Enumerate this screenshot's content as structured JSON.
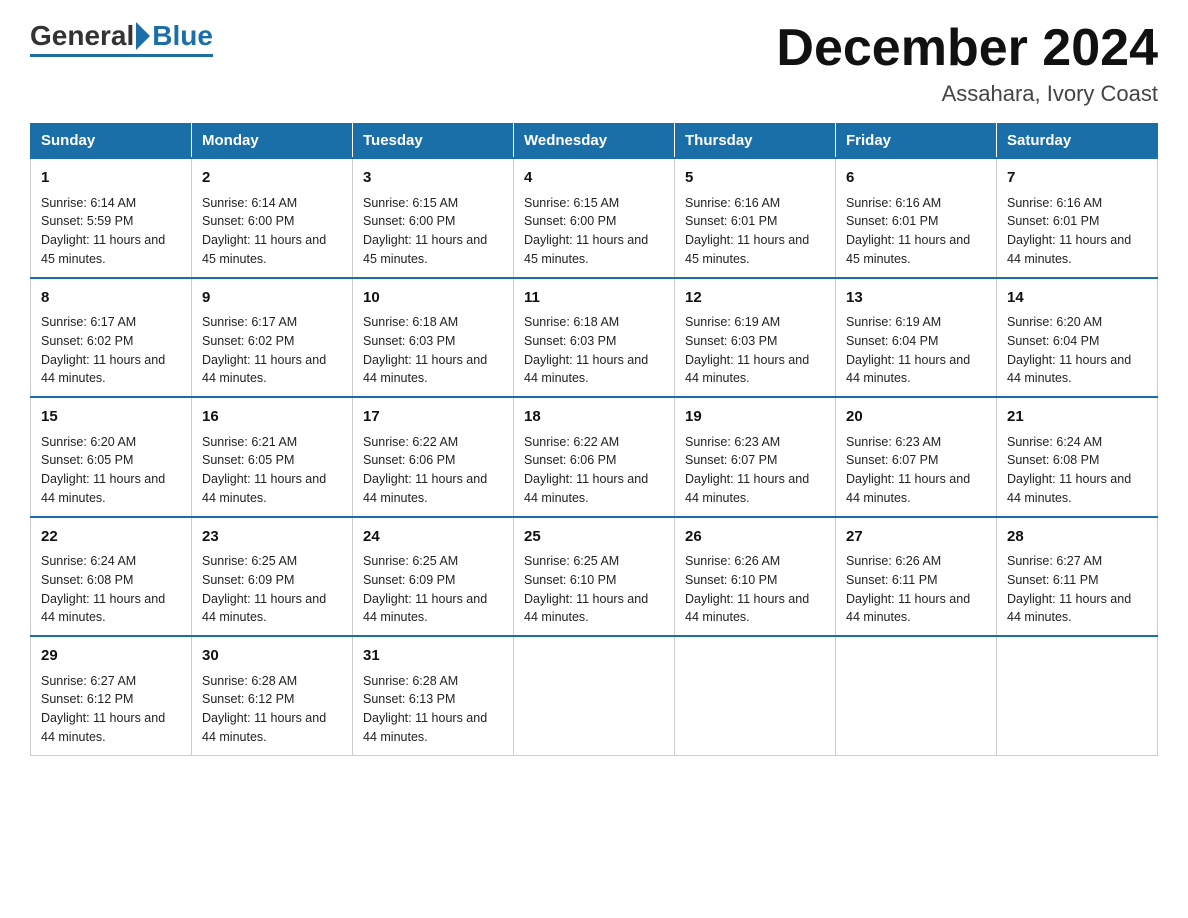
{
  "logo": {
    "general": "General",
    "blue": "Blue"
  },
  "title": "December 2024",
  "location": "Assahara, Ivory Coast",
  "weekdays": [
    "Sunday",
    "Monday",
    "Tuesday",
    "Wednesday",
    "Thursday",
    "Friday",
    "Saturday"
  ],
  "weeks": [
    [
      {
        "day": "1",
        "sunrise": "6:14 AM",
        "sunset": "5:59 PM",
        "daylight": "11 hours and 45 minutes."
      },
      {
        "day": "2",
        "sunrise": "6:14 AM",
        "sunset": "6:00 PM",
        "daylight": "11 hours and 45 minutes."
      },
      {
        "day": "3",
        "sunrise": "6:15 AM",
        "sunset": "6:00 PM",
        "daylight": "11 hours and 45 minutes."
      },
      {
        "day": "4",
        "sunrise": "6:15 AM",
        "sunset": "6:00 PM",
        "daylight": "11 hours and 45 minutes."
      },
      {
        "day": "5",
        "sunrise": "6:16 AM",
        "sunset": "6:01 PM",
        "daylight": "11 hours and 45 minutes."
      },
      {
        "day": "6",
        "sunrise": "6:16 AM",
        "sunset": "6:01 PM",
        "daylight": "11 hours and 45 minutes."
      },
      {
        "day": "7",
        "sunrise": "6:16 AM",
        "sunset": "6:01 PM",
        "daylight": "11 hours and 44 minutes."
      }
    ],
    [
      {
        "day": "8",
        "sunrise": "6:17 AM",
        "sunset": "6:02 PM",
        "daylight": "11 hours and 44 minutes."
      },
      {
        "day": "9",
        "sunrise": "6:17 AM",
        "sunset": "6:02 PM",
        "daylight": "11 hours and 44 minutes."
      },
      {
        "day": "10",
        "sunrise": "6:18 AM",
        "sunset": "6:03 PM",
        "daylight": "11 hours and 44 minutes."
      },
      {
        "day": "11",
        "sunrise": "6:18 AM",
        "sunset": "6:03 PM",
        "daylight": "11 hours and 44 minutes."
      },
      {
        "day": "12",
        "sunrise": "6:19 AM",
        "sunset": "6:03 PM",
        "daylight": "11 hours and 44 minutes."
      },
      {
        "day": "13",
        "sunrise": "6:19 AM",
        "sunset": "6:04 PM",
        "daylight": "11 hours and 44 minutes."
      },
      {
        "day": "14",
        "sunrise": "6:20 AM",
        "sunset": "6:04 PM",
        "daylight": "11 hours and 44 minutes."
      }
    ],
    [
      {
        "day": "15",
        "sunrise": "6:20 AM",
        "sunset": "6:05 PM",
        "daylight": "11 hours and 44 minutes."
      },
      {
        "day": "16",
        "sunrise": "6:21 AM",
        "sunset": "6:05 PM",
        "daylight": "11 hours and 44 minutes."
      },
      {
        "day": "17",
        "sunrise": "6:22 AM",
        "sunset": "6:06 PM",
        "daylight": "11 hours and 44 minutes."
      },
      {
        "day": "18",
        "sunrise": "6:22 AM",
        "sunset": "6:06 PM",
        "daylight": "11 hours and 44 minutes."
      },
      {
        "day": "19",
        "sunrise": "6:23 AM",
        "sunset": "6:07 PM",
        "daylight": "11 hours and 44 minutes."
      },
      {
        "day": "20",
        "sunrise": "6:23 AM",
        "sunset": "6:07 PM",
        "daylight": "11 hours and 44 minutes."
      },
      {
        "day": "21",
        "sunrise": "6:24 AM",
        "sunset": "6:08 PM",
        "daylight": "11 hours and 44 minutes."
      }
    ],
    [
      {
        "day": "22",
        "sunrise": "6:24 AM",
        "sunset": "6:08 PM",
        "daylight": "11 hours and 44 minutes."
      },
      {
        "day": "23",
        "sunrise": "6:25 AM",
        "sunset": "6:09 PM",
        "daylight": "11 hours and 44 minutes."
      },
      {
        "day": "24",
        "sunrise": "6:25 AM",
        "sunset": "6:09 PM",
        "daylight": "11 hours and 44 minutes."
      },
      {
        "day": "25",
        "sunrise": "6:25 AM",
        "sunset": "6:10 PM",
        "daylight": "11 hours and 44 minutes."
      },
      {
        "day": "26",
        "sunrise": "6:26 AM",
        "sunset": "6:10 PM",
        "daylight": "11 hours and 44 minutes."
      },
      {
        "day": "27",
        "sunrise": "6:26 AM",
        "sunset": "6:11 PM",
        "daylight": "11 hours and 44 minutes."
      },
      {
        "day": "28",
        "sunrise": "6:27 AM",
        "sunset": "6:11 PM",
        "daylight": "11 hours and 44 minutes."
      }
    ],
    [
      {
        "day": "29",
        "sunrise": "6:27 AM",
        "sunset": "6:12 PM",
        "daylight": "11 hours and 44 minutes."
      },
      {
        "day": "30",
        "sunrise": "6:28 AM",
        "sunset": "6:12 PM",
        "daylight": "11 hours and 44 minutes."
      },
      {
        "day": "31",
        "sunrise": "6:28 AM",
        "sunset": "6:13 PM",
        "daylight": "11 hours and 44 minutes."
      },
      null,
      null,
      null,
      null
    ]
  ],
  "labels": {
    "sunrise": "Sunrise:",
    "sunset": "Sunset:",
    "daylight": "Daylight:"
  }
}
